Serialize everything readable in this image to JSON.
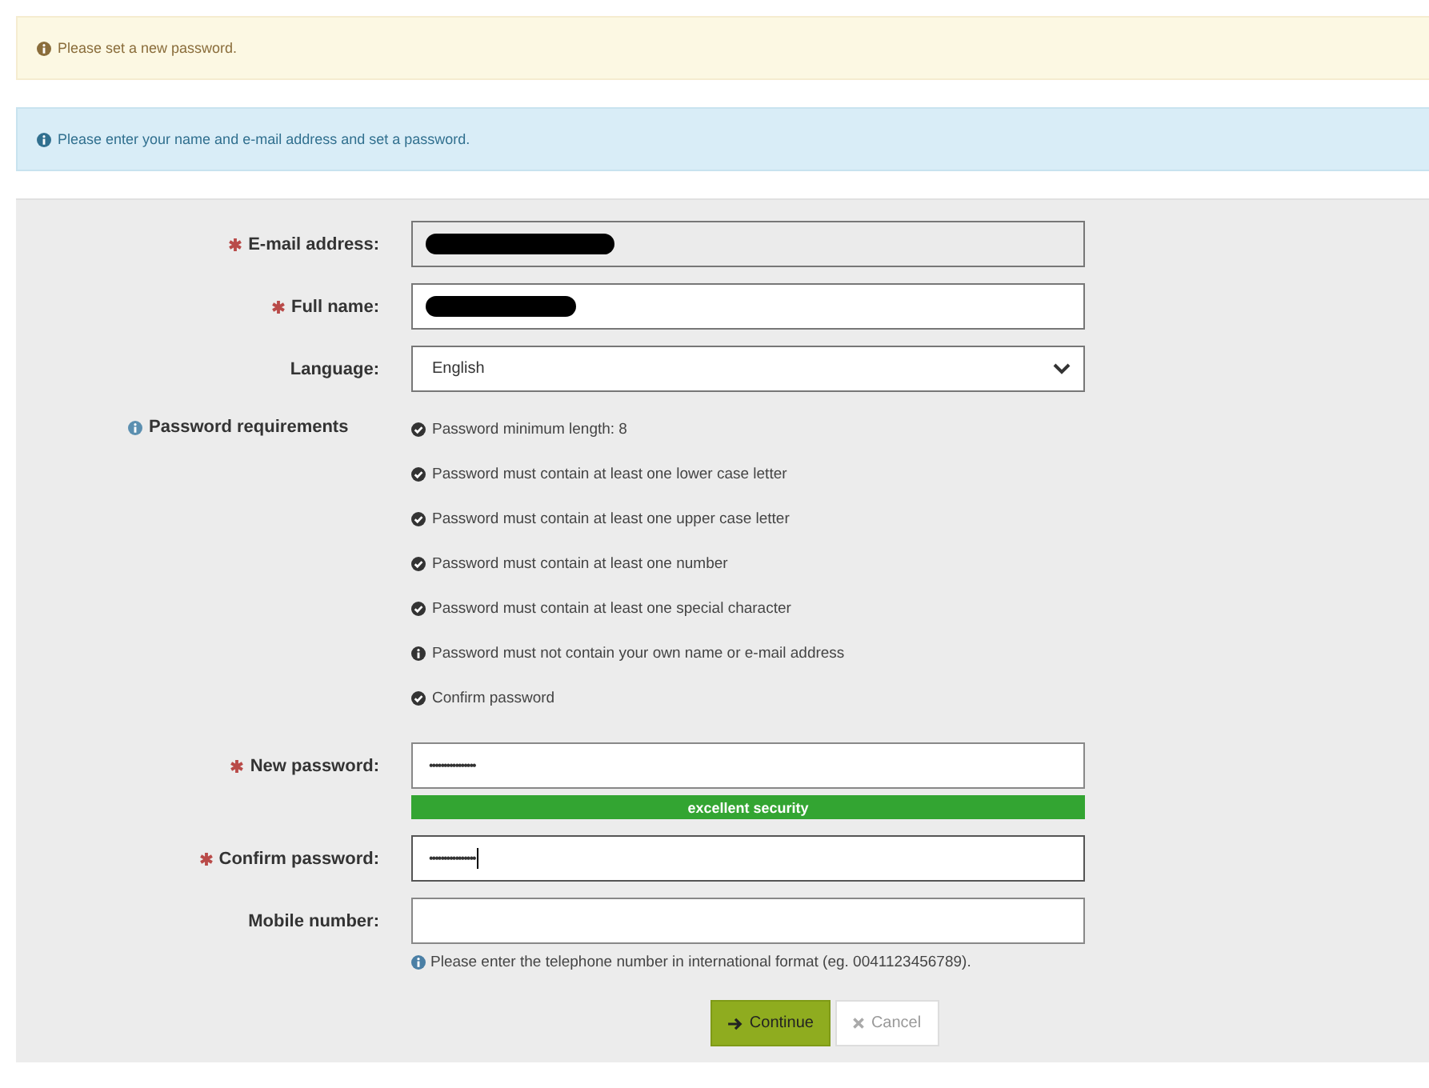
{
  "alerts": [
    {
      "kind": "warning",
      "text": "Please set a new password."
    },
    {
      "kind": "info",
      "text": "Please enter your name and e-mail address and set a password."
    }
  ],
  "fields": [
    {
      "kind": "text",
      "label": "E-mail address:",
      "required": true,
      "disabled": true,
      "redacted": true
    },
    {
      "kind": "text",
      "label": "Full name:",
      "required": true,
      "disabled": false,
      "redacted": true
    },
    {
      "kind": "select",
      "label": "Language:",
      "required": false,
      "value": "English"
    }
  ],
  "requirements": {
    "label": "Password requirements",
    "items": [
      {
        "text": "Password minimum length: 8",
        "met": true
      },
      {
        "text": "Password must contain at least one lower case letter",
        "met": true
      },
      {
        "text": "Password must contain at least one upper case letter",
        "met": true
      },
      {
        "text": "Password must contain at least one number",
        "met": true
      },
      {
        "text": "Password must contain at least one special character",
        "met": true
      },
      {
        "text": "Password must not contain your own name or e-mail address",
        "met": false
      },
      {
        "text": "Confirm password",
        "met": true
      }
    ]
  },
  "password_fields": [
    {
      "label": "New password:",
      "required": true,
      "value": "••••••••••••••••",
      "focused": false,
      "strength": {
        "text": "excellent security",
        "level": 1
      }
    },
    {
      "label": "Confirm password:",
      "required": true,
      "value": "••••••••••••••••",
      "focused": true
    },
    {
      "label": "Mobile number:",
      "required": false,
      "hint": "Please enter the telephone number in international format (eg. 0041123456789)."
    }
  ],
  "buttons": [
    {
      "kind": "primary",
      "label": "Continue"
    },
    {
      "kind": "secondary",
      "label": "Cancel"
    }
  ]
}
